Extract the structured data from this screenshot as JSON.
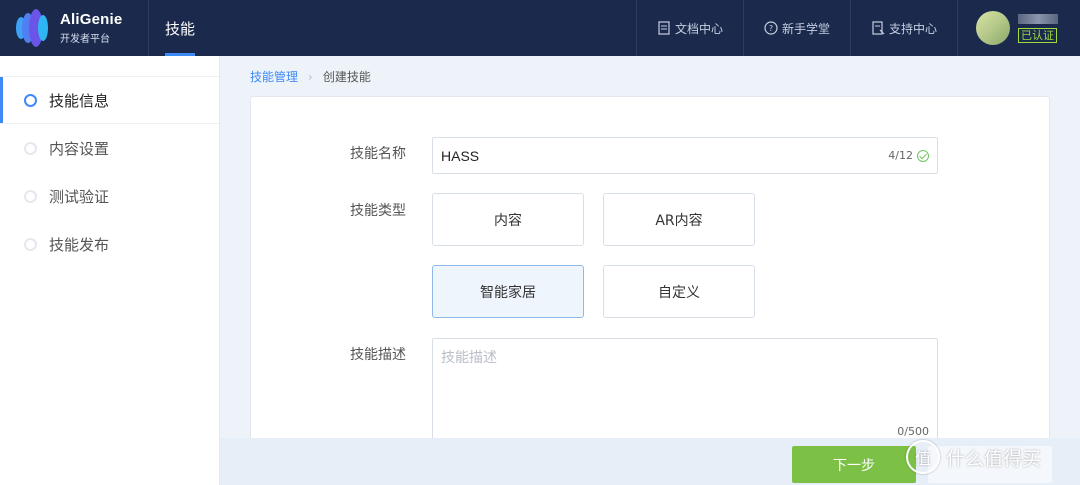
{
  "header": {
    "brand_title": "AliGenie",
    "brand_subtitle": "开发者平台",
    "active_tab": "技能",
    "links": [
      {
        "icon": "document-icon",
        "label": "文档中心"
      },
      {
        "icon": "help-circle-icon",
        "label": "新手学堂"
      },
      {
        "icon": "support-icon",
        "label": "支持中心"
      }
    ],
    "user": {
      "verified_badge": "已认证"
    }
  },
  "sidebar": {
    "items": [
      {
        "label": "技能信息",
        "active": true
      },
      {
        "label": "内容设置",
        "active": false
      },
      {
        "label": "测试验证",
        "active": false
      },
      {
        "label": "技能发布",
        "active": false
      }
    ]
  },
  "breadcrumb": {
    "parent": "技能管理",
    "current": "创建技能"
  },
  "form": {
    "name_label": "技能名称",
    "name_value": "HASS",
    "name_counter": "4/12",
    "type_label": "技能类型",
    "types": [
      "内容",
      "AR内容",
      "智能家居",
      "自定义"
    ],
    "selected_type": "智能家居",
    "desc_label": "技能描述",
    "desc_placeholder": "技能描述",
    "desc_counter": "0/500"
  },
  "footer": {
    "next_label": "下一步"
  },
  "watermark": {
    "logo_char": "值",
    "text": "什么值得买"
  },
  "colors": {
    "header_bg": "#1b2a4c",
    "accent": "#3d8af7",
    "success": "#7cc146",
    "verified": "#9fdc3f"
  }
}
